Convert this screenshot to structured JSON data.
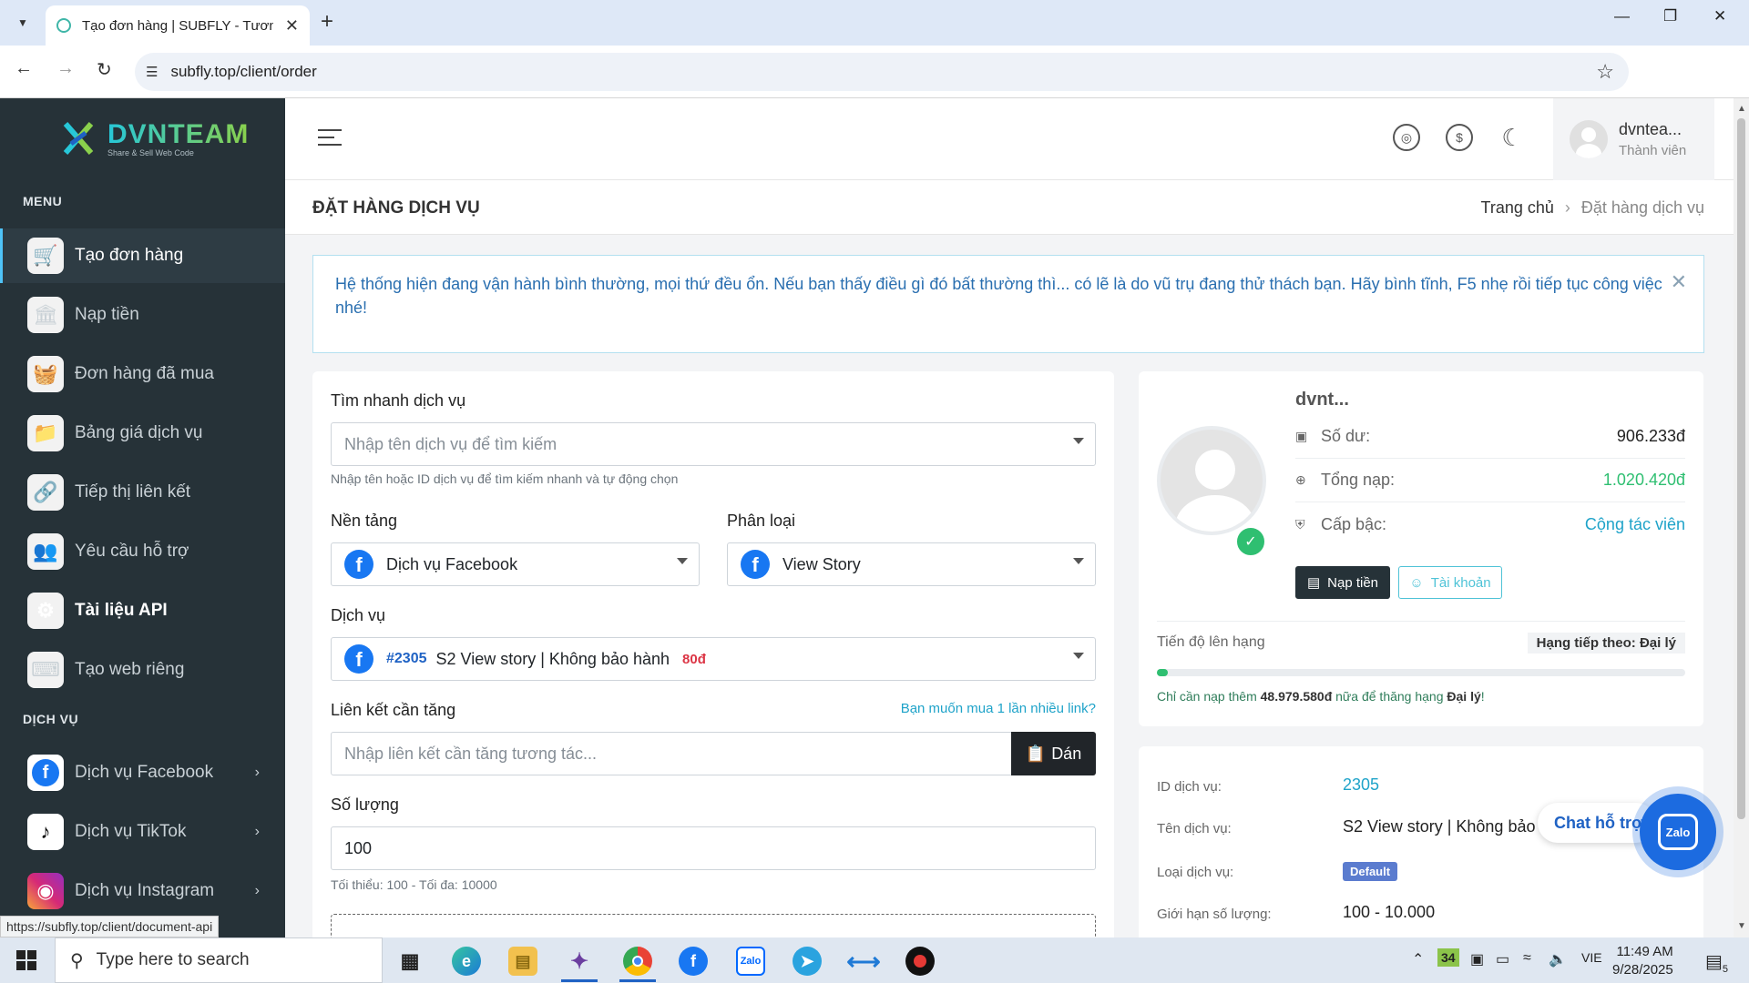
{
  "browser": {
    "tab_title": "Tạo đơn hàng | SUBFLY - Tương",
    "url": "subfly.top/client/order",
    "status_url": "https://subfly.top/client/document-api"
  },
  "sidebar": {
    "logo_text": "DVNTEAM",
    "logo_tagline": "Share & Sell Web Code",
    "menu_heading": "MENU",
    "items": [
      {
        "label": "Tạo đơn hàng",
        "icon": "cart-icon"
      },
      {
        "label": "Nạp tiền",
        "icon": "bank-icon"
      },
      {
        "label": "Đơn hàng đã mua",
        "icon": "basket-icon"
      },
      {
        "label": "Bảng giá dịch vụ",
        "icon": "folder-icon"
      },
      {
        "label": "Tiếp thị liên kết",
        "icon": "link-icon"
      },
      {
        "label": "Yêu cầu hỗ trợ",
        "icon": "support-icon"
      },
      {
        "label": "Tài liệu API",
        "icon": "api-icon"
      },
      {
        "label": "Tạo web riêng",
        "icon": "terminal-icon"
      }
    ],
    "services_heading": "DỊCH VỤ",
    "services": [
      {
        "label": "Dịch vụ Facebook",
        "icon": "facebook-icon"
      },
      {
        "label": "Dịch vụ TikTok",
        "icon": "tiktok-icon"
      },
      {
        "label": "Dịch vụ Instagram",
        "icon": "instagram-icon"
      }
    ]
  },
  "topbar": {
    "user_name": "dvntea...",
    "user_role": "Thành viên"
  },
  "page": {
    "title": "ĐẶT HÀNG DỊCH VỤ",
    "breadcrumb_home": "Trang chủ",
    "breadcrumb_current": "Đặt hàng dịch vụ",
    "alert": "Hệ thống hiện đang vận hành bình thường, mọi thứ đều ổn. Nếu bạn thấy điều gì đó bất thường thì... có lẽ là do vũ trụ đang thử thách bạn. Hãy bình tĩnh, F5 nhẹ rồi tiếp tục công việc nhé!"
  },
  "form": {
    "quick_search_label": "Tìm nhanh dịch vụ",
    "quick_search_placeholder": "Nhập tên dịch vụ để tìm kiếm",
    "quick_search_help": "Nhập tên hoặc ID dịch vụ để tìm kiếm nhanh và tự động chọn",
    "platform_label": "Nền tảng",
    "platform_value": "Dịch vụ Facebook",
    "category_label": "Phân loại",
    "category_value": "View Story",
    "service_label": "Dịch vụ",
    "service_id": "#2305",
    "service_name": "S2 View story | Không bảo hành",
    "service_price": "80đ",
    "link_label": "Liên kết cần tăng",
    "link_multi": "Bạn muốn mua 1 lần nhiều link?",
    "link_placeholder": "Nhập liên kết cần tăng tương tác...",
    "paste_label": "Dán",
    "quantity_label": "Số lượng",
    "quantity_value": "100",
    "quantity_help": "Tối thiểu: 100 - Tối đa: 10000"
  },
  "account": {
    "name": "dvnt...",
    "balance_label": "Số dư:",
    "balance_value": "906.233đ",
    "total_label": "Tổng nạp:",
    "total_value": "1.020.420đ",
    "rank_label": "Cấp bậc:",
    "rank_value": "Cộng tác viên",
    "deposit_button": "Nạp tiền",
    "account_button": "Tài khoản",
    "progress_label": "Tiến độ lên hạng",
    "next_rank": "Hạng tiếp theo: Đại lý",
    "progress_fraction": 0.02,
    "progress_text_pre": "Chỉ cần nạp thêm",
    "progress_amount": "48.979.580đ",
    "progress_text_mid": "nữa để thăng hạng",
    "progress_rank": "Đại lý",
    "colors": {
      "total": "#2fbf71",
      "rank": "#1fa3c9"
    }
  },
  "service_info": {
    "id_label": "ID dịch vụ:",
    "id_value": "2305",
    "name_label": "Tên dịch vụ:",
    "name_value": "S2 View story | Không bảo h",
    "type_label": "Loại dịch vụ:",
    "type_value": "Default",
    "limit_label": "Giới hạn số lượng:",
    "limit_value": "100 - 10.000"
  },
  "chat": {
    "label": "Chat hỗ trợ",
    "zalo": "Zalo"
  },
  "taskbar": {
    "search_placeholder": "Type here to search",
    "weather_badge": "34",
    "lang": "VIE",
    "time": "11:49 AM",
    "date": "9/28/2025",
    "notif_count": "5"
  }
}
